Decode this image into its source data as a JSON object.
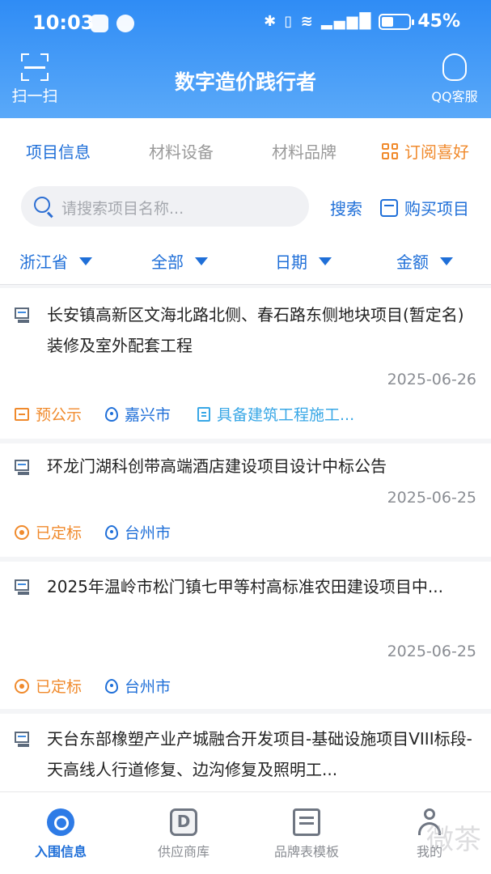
{
  "status": {
    "time": "10:03",
    "battery": "45%",
    "battery_level": 0.45
  },
  "header": {
    "scan_label": "扫一扫",
    "title": "数字造价践行者",
    "service_label": "QQ客服"
  },
  "tabs": [
    {
      "label": "项目信息",
      "active": true
    },
    {
      "label": "材料设备",
      "active": false
    },
    {
      "label": "材料品牌",
      "active": false
    },
    {
      "label": "订阅喜好",
      "active": false
    }
  ],
  "search": {
    "placeholder": "请搜索项目名称...",
    "button": "搜索",
    "buy": "购买项目"
  },
  "filters": [
    {
      "label": "浙江省"
    },
    {
      "label": "全部"
    },
    {
      "label": "日期"
    },
    {
      "label": "金额"
    }
  ],
  "items": [
    {
      "title": "长安镇高新区文海北路北侧、春石路东侧地块项目(暂定名)装修及室外配套工程",
      "date": "2025-06-26",
      "status": "预公示",
      "city": "嘉兴市",
      "qualification": "具备建筑工程施工..."
    },
    {
      "title": "环龙门湖科创带高端酒店建设项目设计中标公告",
      "date": "2025-06-25",
      "status": "已定标",
      "city": "台州市"
    },
    {
      "title": "2025年温岭市松门镇七甲等村高标准农田建设项目中...",
      "date": "2025-06-25",
      "status": "已定标",
      "city": "台州市"
    },
    {
      "title": "天台东部橡塑产业产城融合开发项目-基础设施项目VIII标段-天高线人行道修复、边沟修复及照明工..."
    }
  ],
  "nav": [
    {
      "label": "入围信息",
      "active": true
    },
    {
      "label": "供应商库",
      "active": false
    },
    {
      "label": "品牌表模板",
      "active": false
    },
    {
      "label": "我的",
      "active": false
    }
  ],
  "watermark": "微茶"
}
